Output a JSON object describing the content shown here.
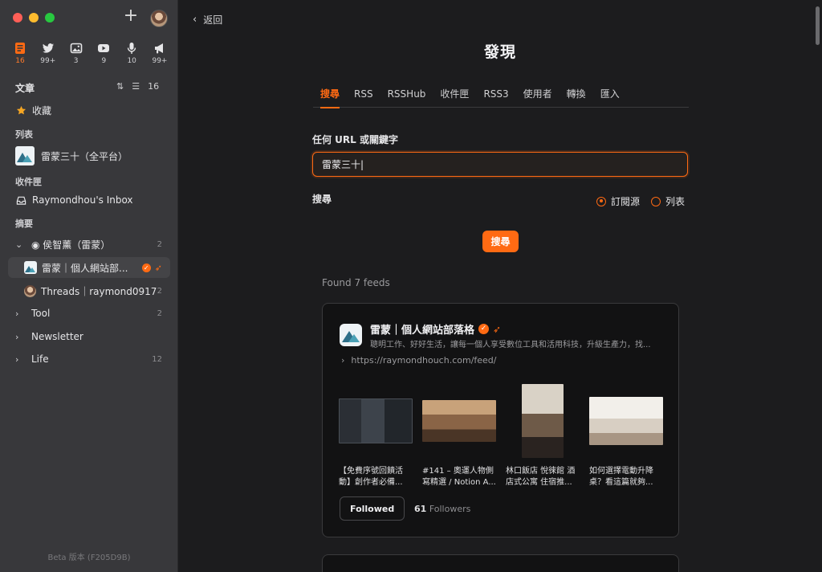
{
  "sidebar": {
    "views": [
      {
        "icon": "article-icon",
        "count": "16",
        "active": true
      },
      {
        "icon": "twitter-icon",
        "count": "99+"
      },
      {
        "icon": "picture-icon",
        "count": "3"
      },
      {
        "icon": "video-icon",
        "count": "9"
      },
      {
        "icon": "microphone-icon",
        "count": "10"
      },
      {
        "icon": "megaphone-icon",
        "count": "99+"
      }
    ],
    "section_title": "文章",
    "section_count": "16",
    "favorites_label": "收藏",
    "lists_label": "列表",
    "list_item": "雷蒙三十（全平台）",
    "inbox_label": "收件匣",
    "inbox_item": "Raymondhou's Inbox",
    "digest_label": "摘要",
    "folder_main": {
      "label": "◉ 侯智薰（雷蒙）",
      "count": "2"
    },
    "feed_selected": "雷蒙｜個人網站部...",
    "feed_threads": {
      "label": "Threads｜raymond0917",
      "count": "2"
    },
    "folders": [
      {
        "label": "Tool",
        "count": "2"
      },
      {
        "label": "Newsletter",
        "count": ""
      },
      {
        "label": "Life",
        "count": "12"
      }
    ],
    "beta": "Beta 版本 (F205D9B)"
  },
  "main": {
    "back": "返回",
    "title": "發現",
    "tabs": [
      "搜尋",
      "RSS",
      "RSSHub",
      "收件匣",
      "RSS3",
      "使用者",
      "轉換",
      "匯入"
    ],
    "field_label": "任何 URL 或關鍵字",
    "search_value": "雷蒙三十|",
    "search_label": "搜尋",
    "radio_feeds": "訂閱源",
    "radio_lists": "列表",
    "search_button": "搜尋",
    "found": "Found 7 feeds",
    "feed": {
      "title": "雷蒙｜個人網站部落格",
      "description": "聰明工作、好好生活，讓每一個人享受數位工具和活用科技，升級生產力，找...",
      "url": "https://raymondhouch.com/feed/",
      "entries": [
        "【免費序號回饋活動】創作者必備...",
        "#141 – 奧運人物側寫精選 / Notion A...",
        "林口飯店 悅徠館 酒店式公寓 住宿推...",
        "如何選擇電動升降桌？看這篇就夠..."
      ],
      "followed_button": "Followed",
      "followers_count": "61",
      "followers_label": "Followers"
    }
  },
  "colors": {
    "accent": "#ff6a13",
    "sidebar_bg": "#38383b",
    "main_bg": "#1c1c1e",
    "card_bg": "#121213"
  }
}
